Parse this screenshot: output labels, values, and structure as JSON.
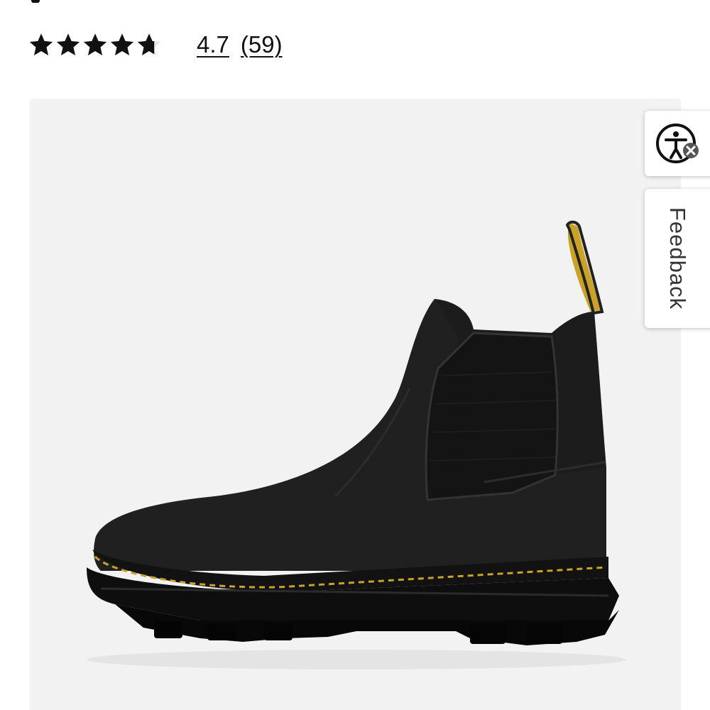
{
  "product": {
    "rating": {
      "stars_filled": 4.7,
      "stars_total": 5,
      "value": "4.7",
      "count": "(59)"
    },
    "image": {
      "icon": "chelsea-boot-image",
      "background_color": "#f2f2f2",
      "boot_color": "#1c1c1c",
      "stitch_color": "#c9a227"
    }
  },
  "side_widgets": {
    "accessibility_icon": "accessibility-icon",
    "feedback_label": "Feedback"
  }
}
